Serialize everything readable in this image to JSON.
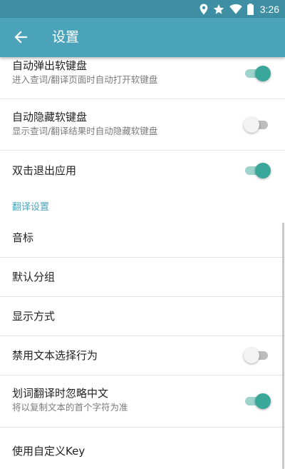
{
  "status_bar": {
    "time": "3:26",
    "icons": [
      "location-icon",
      "star-icon",
      "wifi-icon",
      "battery-icon"
    ]
  },
  "app_bar": {
    "title": "设置",
    "back_icon": "arrow-left-icon"
  },
  "colors": {
    "status_bar": "#3e8fa3",
    "app_bar": "#4aa3b8",
    "accent": "#39a89a",
    "section_header": "#4aa3b8"
  },
  "settings": {
    "auto_popup_keyboard": {
      "title": "自动弹出软键盘",
      "subtitle": "进入查词/翻译页面时自动打开软键盘",
      "enabled": true
    },
    "auto_hide_keyboard": {
      "title": "自动隐藏软键盘",
      "subtitle": "显示查词/翻译结果时自动隐藏软键盘",
      "enabled": false
    },
    "double_tap_exit": {
      "title": "双击退出应用",
      "enabled": true
    },
    "translation_section": {
      "header": "翻译设置"
    },
    "phonetic": {
      "title": "音标"
    },
    "default_group": {
      "title": "默认分组"
    },
    "display_mode": {
      "title": "显示方式"
    },
    "disable_text_selection": {
      "title": "禁用文本选择行为",
      "enabled": false
    },
    "ignore_chinese": {
      "title": "划词翻译时忽略中文",
      "subtitle": "将以复制文本的首个字符为准",
      "enabled": true
    },
    "custom_key": {
      "title": "使用自定义Key"
    }
  }
}
